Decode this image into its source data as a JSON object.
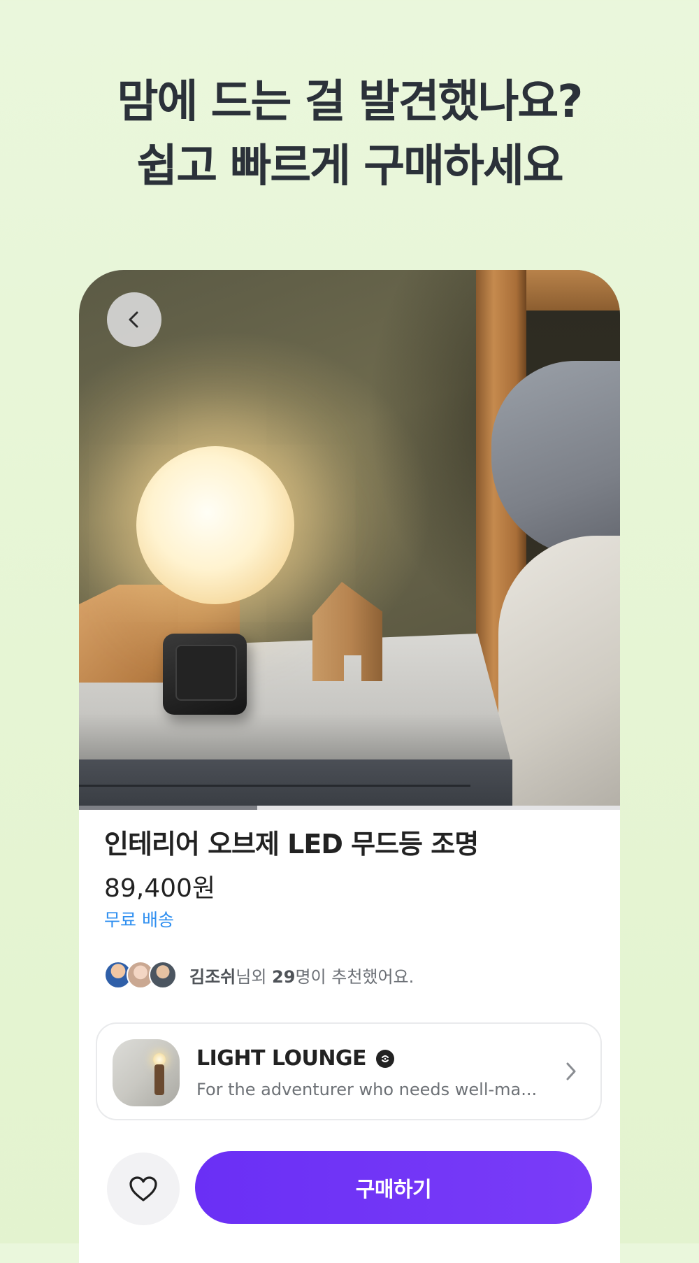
{
  "headline": {
    "line1": "맘에 드는 걸 발견했나요?",
    "line2": "쉽고 빠르게 구매하세요"
  },
  "product": {
    "title": "인테리어 오브제 LED 무드등 조명",
    "price": "89,400원",
    "shipping": "무료 배송",
    "image_progress": 0.33
  },
  "recommendation": {
    "name": "김조쉬",
    "text1": "님외 ",
    "count": "29",
    "text2": "명이 추천했어요."
  },
  "shop": {
    "name": "LIGHT LOUNGE",
    "description": "For the adventurer who needs well-ma..."
  },
  "actions": {
    "buy_label": "구매하기"
  },
  "icons": {
    "back": "chevron-left-icon",
    "verified": "verified-badge-icon",
    "shop_arrow": "chevron-right-icon",
    "like": "heart-icon"
  },
  "colors": {
    "accent": "#7136f6",
    "link": "#2f8ff0",
    "background": "#e8f6d8"
  }
}
